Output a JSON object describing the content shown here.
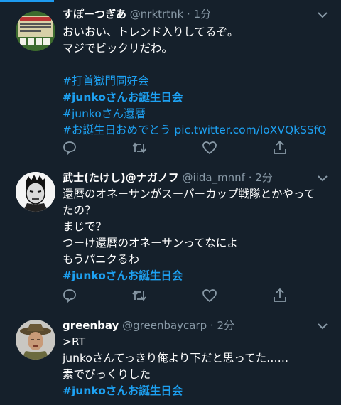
{
  "colors": {
    "background": "#15202b",
    "link": "#1da1f2",
    "muted": "#8899a6",
    "divider": "#38444d"
  },
  "tweets": [
    {
      "name": "すぽーつぎあ",
      "handle": "@nrktrtnk · 1分",
      "lines": [
        {
          "text": "おいおい、トレンド入りしてるぞ。",
          "style": "normal"
        },
        {
          "text": "マジでビックリだわ。",
          "style": "normal"
        },
        {
          "text": "",
          "style": "normal"
        },
        {
          "text": "#打首獄門同好会",
          "style": "link"
        },
        {
          "text": "#junkoさんお誕生日会",
          "style": "link-bold"
        },
        {
          "text": "#junkoさん還暦",
          "style": "link"
        },
        {
          "text": "#お誕生日おめでとう pic.twitter.com/loXVQkSSfQ",
          "style": "link"
        }
      ]
    },
    {
      "name": "武士(たけし)@ナガノフ",
      "handle": "@iida_mnnf · 2分",
      "lines": [
        {
          "text": "還暦のオネーサンがスーパーカップ戦隊とかやって",
          "style": "normal"
        },
        {
          "text": "たの？",
          "style": "normal"
        },
        {
          "text": "まじで？",
          "style": "normal"
        },
        {
          "text": "つーけ還暦のオネーサンってなによ",
          "style": "normal"
        },
        {
          "text": "もうパニクるわ",
          "style": "normal"
        },
        {
          "text": "#junkoさんお誕生日会",
          "style": "link-bold"
        }
      ]
    },
    {
      "name": "greenbay",
      "handle": "@greenbaycarp · 2分",
      "lines": [
        {
          "text": ">RT",
          "style": "normal"
        },
        {
          "text": "junkoさんてっきり俺より下だと思ってた……",
          "style": "normal"
        },
        {
          "text": "素でびっくりした",
          "style": "normal"
        },
        {
          "text": "#junkoさんお誕生日会",
          "style": "link-bold"
        }
      ]
    }
  ],
  "icons": [
    "reply-icon",
    "retweet-icon",
    "like-icon",
    "share-icon",
    "chevron-down-icon"
  ]
}
